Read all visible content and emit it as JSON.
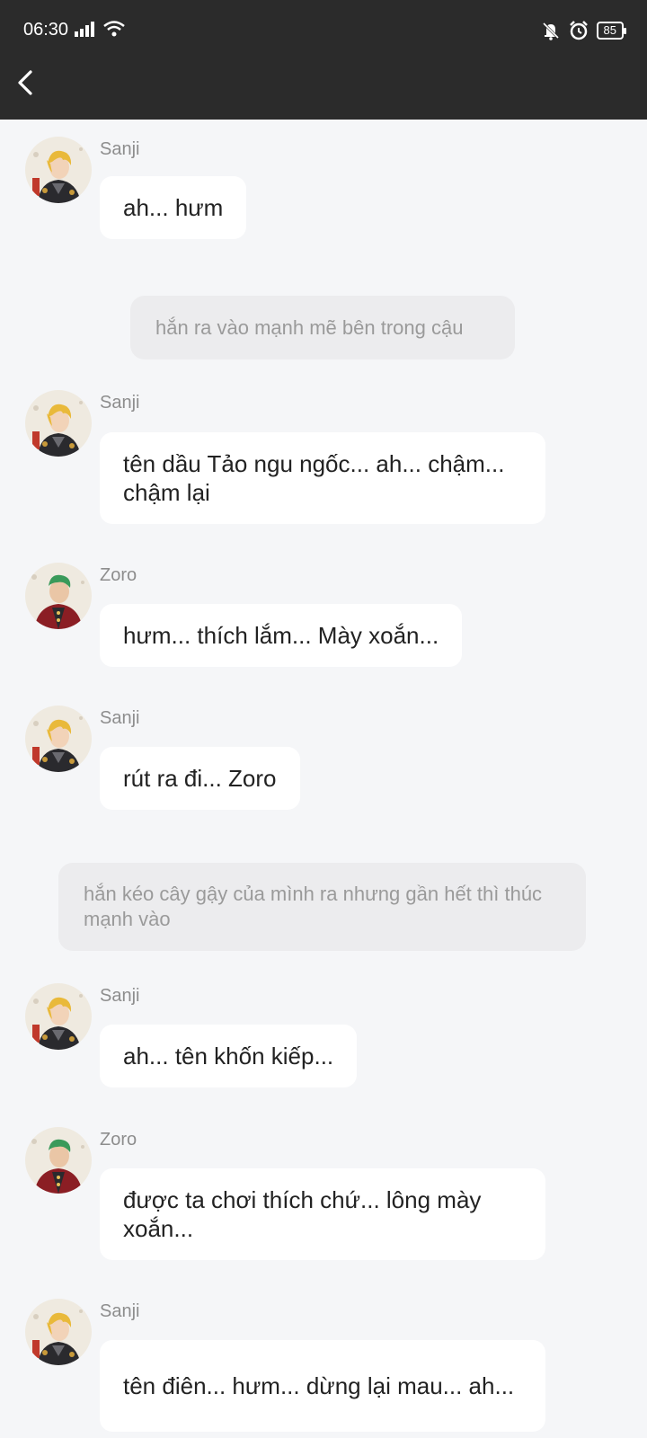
{
  "status_bar": {
    "time": "06:30",
    "battery": "85",
    "icons": [
      "signal-icon",
      "wifi-icon",
      "mute-bell-icon",
      "alarm-icon",
      "battery-icon"
    ]
  },
  "header": {
    "back_icon": "chevron-left-icon"
  },
  "messages": [
    {
      "type": "chat",
      "sender": "Sanji",
      "text": "ah... hưm",
      "avatar": "sanji-avatar"
    },
    {
      "type": "narration",
      "text": "hắn ra vào mạnh mẽ bên trong cậu"
    },
    {
      "type": "chat",
      "sender": "Sanji",
      "text": "tên dầu Tảo ngu ngốc... ah... chậm... chậm lại",
      "avatar": "sanji-avatar"
    },
    {
      "type": "chat",
      "sender": "Zoro",
      "text": "hưm... thích lắm... Mày xoắn...",
      "avatar": "zoro-avatar"
    },
    {
      "type": "chat",
      "sender": "Sanji",
      "text": "rút ra đi... Zoro",
      "avatar": "sanji-avatar"
    },
    {
      "type": "narration",
      "text": "hắn kéo cây gậy của mình ra nhưng gần hết thì thúc mạnh vào"
    },
    {
      "type": "chat",
      "sender": "Sanji",
      "text": "ah... tên khốn kiếp...",
      "avatar": "sanji-avatar"
    },
    {
      "type": "chat",
      "sender": "Zoro",
      "text": "được ta chơi thích chứ... lông mày xoắn...",
      "avatar": "zoro-avatar"
    },
    {
      "type": "chat",
      "sender": "Sanji",
      "text": "tên điên... hưm... dừng lại mau... ah...",
      "avatar": "sanji-avatar"
    }
  ],
  "colors": {
    "header_bg": "#2b2b2b",
    "page_bg": "#f5f6f8",
    "bubble_bg": "#ffffff",
    "narration_bg": "#ececee",
    "sanji_hair": "#e9b93a",
    "zoro_hair": "#3a9a5a"
  }
}
